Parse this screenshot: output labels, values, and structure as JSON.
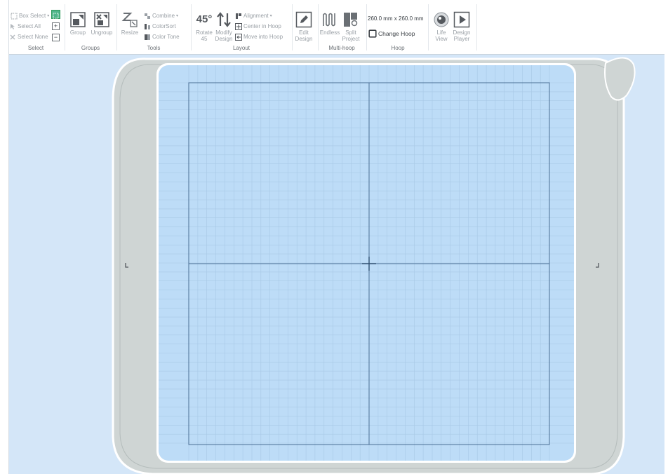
{
  "ribbon": {
    "select": {
      "label": "Select",
      "box_select": "Box Select",
      "select_all": "Select All",
      "select_none": "Select None"
    },
    "groups": {
      "label": "Groups",
      "group": "Group",
      "ungroup": "Ungroup"
    },
    "tools": {
      "label": "Tools",
      "resize": "Resize",
      "combine": "Combine",
      "colorsort": "ColorSort",
      "color_tone": "Color Tone"
    },
    "layout": {
      "label": "Layout",
      "rotate_line1": "Rotate",
      "rotate_line2": "45",
      "modify_line1": "Modify",
      "modify_line2": "Design",
      "alignment": "Alignment",
      "center_in_hoop": "Center in Hoop",
      "move_into_hoop": "Move into Hoop"
    },
    "edit": {
      "line1": "Edit",
      "line2": "Design"
    },
    "multihoop": {
      "label": "Multi-hoop",
      "endless": "Endless",
      "split_line1": "Split",
      "split_line2": "Project"
    },
    "hoop": {
      "label": "Hoop",
      "size": "260.0 mm x 260.0 mm",
      "change_hoop": "Change Hoop"
    },
    "view": {
      "life_line1": "Life",
      "life_line2": "View",
      "player_line1": "Design",
      "player_line2": "Player"
    }
  },
  "colors": {
    "canvas_bg": "#d4e6f8",
    "hoop_frame": "#cfd5d4",
    "sew_area": "#bddcf7",
    "grid_line": "#9cbedc",
    "accent": "#2e9a5c"
  },
  "icons": {
    "rotate_glyph": "45°"
  }
}
